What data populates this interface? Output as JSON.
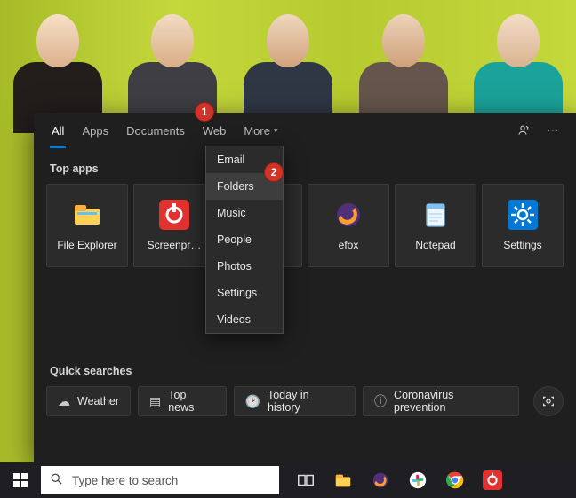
{
  "tabs": {
    "all": "All",
    "apps": "Apps",
    "documents": "Documents",
    "web": "Web",
    "more": "More"
  },
  "sections": {
    "top_apps": "Top apps",
    "quick_searches": "Quick searches"
  },
  "top_apps": [
    {
      "label": "File Explorer"
    },
    {
      "label": "Screenpr…"
    },
    {
      "label": ""
    },
    {
      "label": "efox"
    },
    {
      "label": "Notepad"
    },
    {
      "label": "Settings"
    }
  ],
  "more_menu": [
    "Email",
    "Folders",
    "Music",
    "People",
    "Photos",
    "Settings",
    "Videos"
  ],
  "quick_searches": [
    "Weather",
    "Top news",
    "Today in history",
    "Coronavirus prevention"
  ],
  "badges": {
    "one": "1",
    "two": "2"
  },
  "taskbar": {
    "search_placeholder": "Type here to search"
  }
}
